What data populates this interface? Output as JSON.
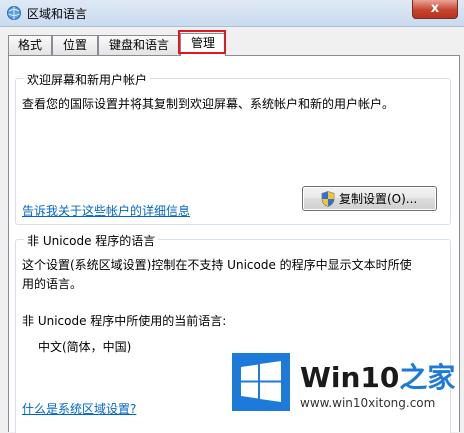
{
  "window": {
    "title": "区域和语言",
    "close_label": "x"
  },
  "tabs": [
    {
      "label": "格式",
      "active": false
    },
    {
      "label": "位置",
      "active": false
    },
    {
      "label": "键盘和语言",
      "active": false
    },
    {
      "label": "管理",
      "active": true
    }
  ],
  "welcome_group": {
    "title": "欢迎屏幕和新用户帐户",
    "description": "查看您的国际设置并将其复制到欢迎屏幕、系统帐户和新的用户帐户。",
    "copy_button_label": "复制设置(O)...",
    "link": "告诉我关于这些帐户的详细信息"
  },
  "unicode_group": {
    "title": "非 Unicode 程序的语言",
    "description_line1": "这个设置(系统区域设置)控制在不支持 Unicode 的程序中显示文本时所使",
    "description_line2": "用的语言。",
    "current_label": "非 Unicode 程序中所使用的当前语言:",
    "current_value": "中文(简体，中国)",
    "link": "什么是系统区域设置?"
  },
  "watermark": {
    "brand_prefix": "Win10",
    "brand_suffix": "之家",
    "url": "www.win10xitong.com"
  },
  "colors": {
    "link": "#0066cc",
    "highlight_border": "#e0191f",
    "brand_blue": "#1e7ad8"
  }
}
